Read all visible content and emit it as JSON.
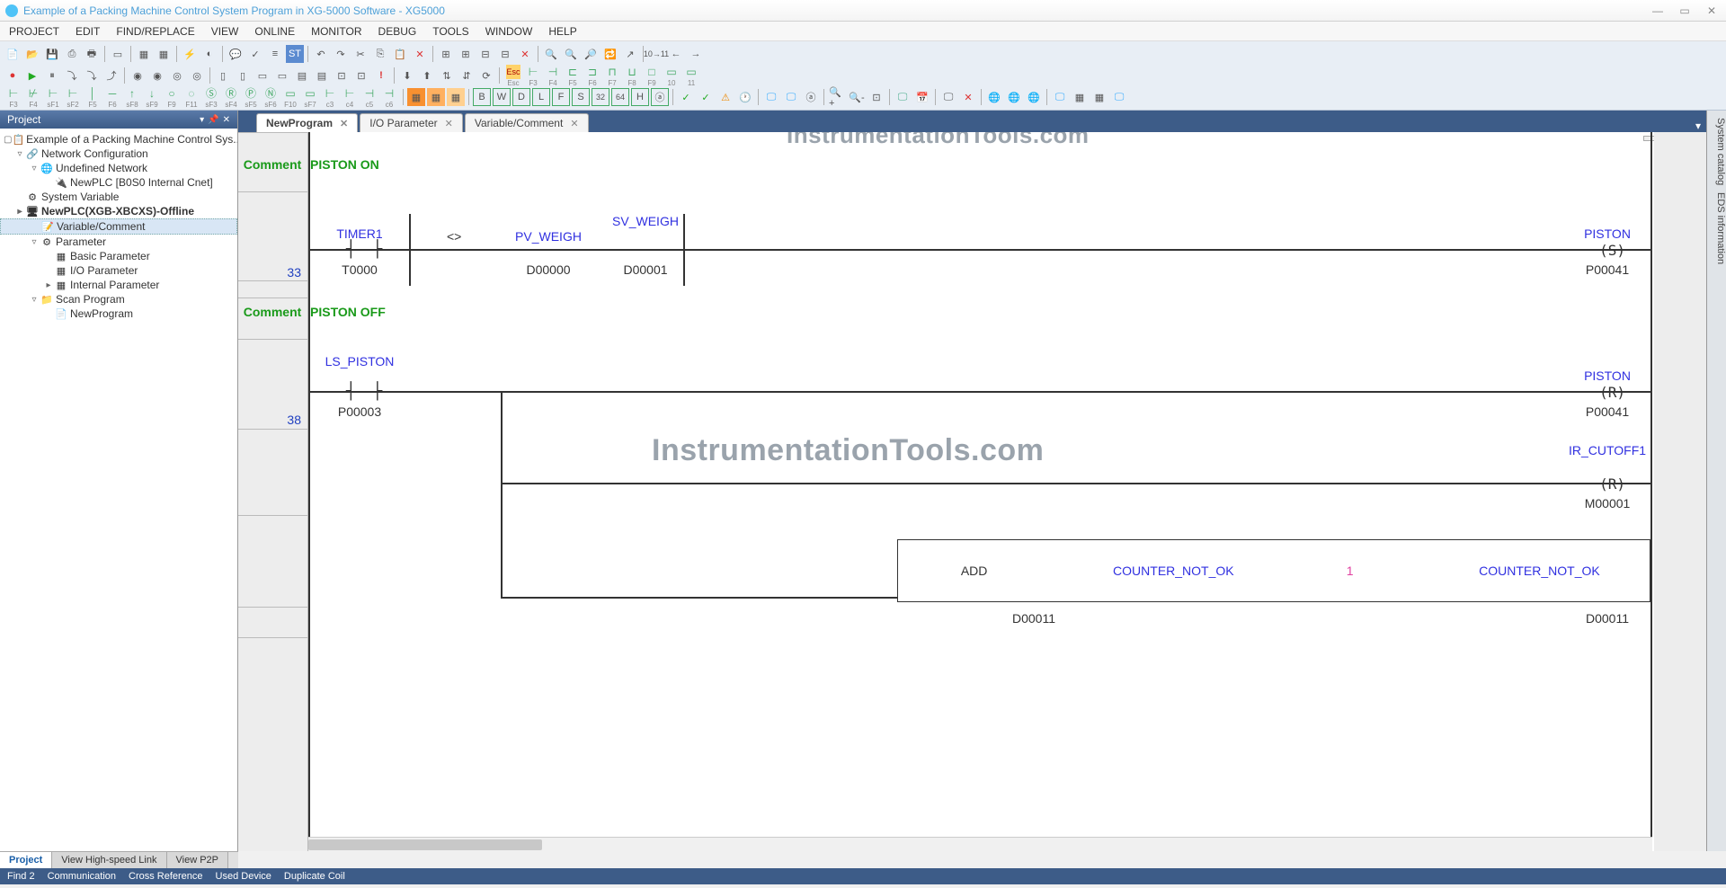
{
  "window": {
    "title": "Example of a Packing Machine Control System Program in XG-5000 Software - XG5000"
  },
  "menu": [
    "PROJECT",
    "EDIT",
    "FIND/REPLACE",
    "VIEW",
    "ONLINE",
    "MONITOR",
    "DEBUG",
    "TOOLS",
    "WINDOW",
    "HELP"
  ],
  "fkeys_row1": [
    "F3",
    "F4",
    "sF1",
    "sF2",
    "F5",
    "F6",
    "sF8",
    "sF9",
    "F9",
    "F11",
    "sF3",
    "sF4",
    "sF5",
    "sF6",
    "F10",
    "sF7",
    "c3",
    "c4",
    "c5",
    "c6"
  ],
  "fkeys_row2": [
    "Esc",
    "F3",
    "F4",
    "F5",
    "F6",
    "F7",
    "F8",
    "F9",
    "10",
    "11"
  ],
  "project_panel": {
    "title": "Project",
    "root": "Example of a Packing Machine Control Sys...",
    "nodes": {
      "net_config": "Network Configuration",
      "undef_net": "Undefined Network",
      "newplc_cnet": "NewPLC [B0S0 Internal Cnet]",
      "sys_var": "System Variable",
      "newplc": "NewPLC(XGB-XBCXS)-Offline",
      "var_comment": "Variable/Comment",
      "parameter": "Parameter",
      "basic_param": "Basic Parameter",
      "io_param": "I/O Parameter",
      "internal_param": "Internal Parameter",
      "scan_prog": "Scan Program",
      "new_program": "NewProgram"
    },
    "bottom_tabs": [
      "Project",
      "View High-speed Link",
      "View P2P"
    ]
  },
  "editor_tabs": [
    {
      "label": "NewProgram",
      "active": true
    },
    {
      "label": "I/O Parameter",
      "active": false
    },
    {
      "label": "Variable/Comment",
      "active": false
    }
  ],
  "right_sidebar": [
    "System catalog",
    "EDS information"
  ],
  "statusbar": [
    "Find 2",
    "Communication",
    "Cross Reference",
    "Used Device",
    "Duplicate Coil"
  ],
  "watermark": "InstrumentationTools.com",
  "ladder": {
    "rung1": {
      "comment_label": "Comment",
      "comment_text": "PISTON ON",
      "step": "33",
      "timer_name": "TIMER1",
      "timer_addr": "T0000",
      "cmp": "<>",
      "pv_name": "PV_WEIGH",
      "pv_addr": "D00000",
      "sv_name": "SV_WEIGH",
      "sv_addr": "D00001",
      "coil_name": "PISTON",
      "coil_sym": "S",
      "coil_addr": "P00041"
    },
    "rung2": {
      "comment_label": "Comment",
      "comment_text": "PISTON OFF",
      "step": "38",
      "ls_name": "LS_PISTON",
      "ls_addr": "P00003",
      "coil1_name": "PISTON",
      "coil1_sym": "R",
      "coil1_addr": "P00041",
      "coil2_name": "IR_CUTOFF1",
      "coil2_sym": "R",
      "coil2_addr": "M00001",
      "func_name": "ADD",
      "func_arg1": "COUNTER_NOT_OK",
      "func_arg1_addr": "D00011",
      "func_const": "1",
      "func_out": "COUNTER_NOT_OK",
      "func_out_addr": "D00011"
    }
  }
}
